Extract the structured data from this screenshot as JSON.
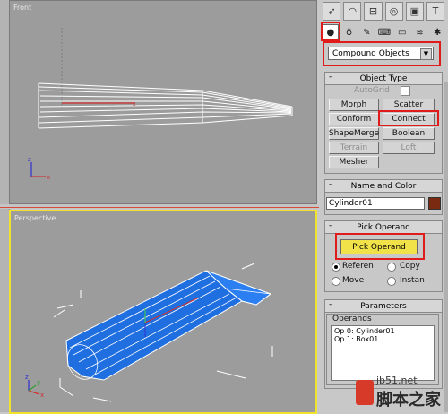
{
  "viewports": {
    "front_label": "Front",
    "persp_label": "Perspective"
  },
  "command_panel": {
    "tabs": [
      "create-icon",
      "modify-icon",
      "hierarchy-icon",
      "motion-icon",
      "display-icon",
      "utilities-icon"
    ],
    "subtabs": [
      "geometry-icon",
      "shapes-icon",
      "lights-icon",
      "cameras-icon",
      "helpers-icon",
      "spacewarps-icon",
      "systems-icon"
    ],
    "category_dropdown": "Compound Objects",
    "object_type": {
      "title": "Object Type",
      "autogrid": "AutoGrid",
      "buttons": [
        "Morph",
        "Scatter",
        "Conform",
        "Connect",
        "ShapeMerge",
        "Boolean",
        "Terrain",
        "Loft",
        "Mesher"
      ]
    },
    "name_color": {
      "title": "Name and Color",
      "name": "Cylinder01",
      "color": "#7a2a10"
    },
    "pick_operand": {
      "title": "Pick Operand",
      "button": "Pick Operand",
      "radios": [
        "Referen",
        "Copy",
        "Move",
        "Instan"
      ]
    },
    "parameters": {
      "title": "Parameters",
      "operands_label": "Operands",
      "operands": [
        "Op 0: Cylinder01",
        "Op 1: Box01"
      ]
    }
  },
  "watermark": {
    "line1": "jb51.net",
    "line2": "脚本之家"
  },
  "colors": {
    "highlight": "#e01b1b",
    "active_viewport": "#f1e22c",
    "object_blue": "#1f6fe0"
  }
}
